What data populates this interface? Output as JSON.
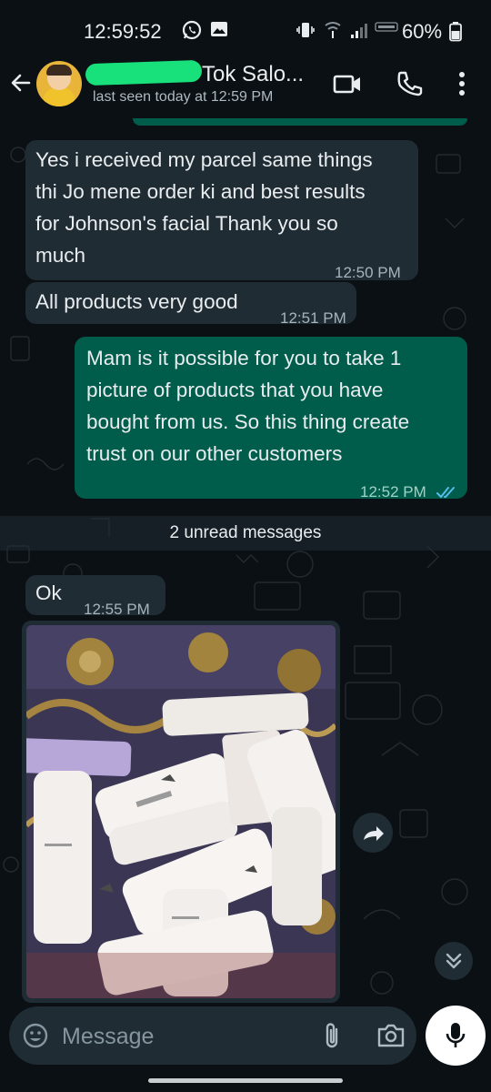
{
  "status_bar": {
    "time": "12:59:52",
    "battery": "60%",
    "icons": [
      "whatsapp-icon",
      "gallery-icon",
      "vibrate-icon",
      "wifi-icon",
      "signal-icon",
      "volte-icon",
      "battery-icon"
    ]
  },
  "header": {
    "contact_name": "Tok Salo...",
    "last_seen": "last seen today at 12:59 PM",
    "icons": [
      "back-arrow-icon",
      "video-call-icon",
      "voice-call-icon",
      "more-options-icon"
    ]
  },
  "messages": [
    {
      "direction": "in",
      "text": "Yes i received my parcel same things\nthi Jo mene order ki and best results\nfor Johnson's facial Thank you so\nmuch",
      "time": "12:50 PM"
    },
    {
      "direction": "in",
      "text": "All products very good",
      "time": "12:51 PM"
    },
    {
      "direction": "out",
      "text": "Mam is it possible for you to take 1\npicture of products that you have\nbought from us. So this  thing create\ntrust on our other customers",
      "time": "12:52 PM",
      "status": "read"
    },
    {
      "direction": "in",
      "text": "Ok",
      "time": "12:55 PM"
    },
    {
      "direction": "in",
      "type": "image",
      "icon": "photo-of-skincare-products"
    }
  ],
  "unread_label": "2 unread messages",
  "composer": {
    "placeholder": "Message",
    "icons": [
      "emoji-icon",
      "attach-icon",
      "camera-icon",
      "mic-icon"
    ]
  },
  "colors": {
    "background": "#0b1014",
    "incoming_bubble": "#202c33",
    "outgoing_bubble": "#005c4b",
    "read_ticks": "#53bdeb"
  }
}
